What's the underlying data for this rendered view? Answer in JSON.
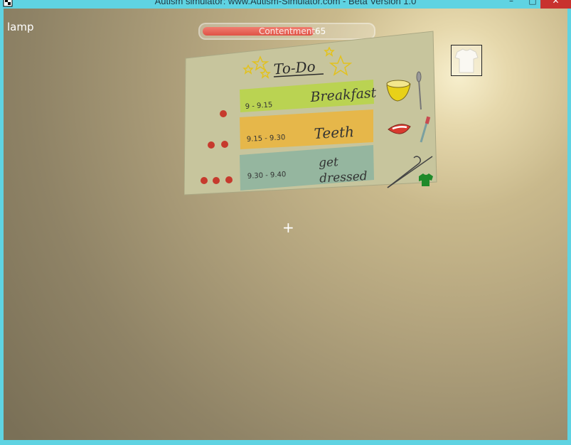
{
  "window": {
    "title": "Autism simulator: www.Autism-Simulator.com - Beta Version 1.0",
    "minimize_glyph": "–",
    "maximize_glyph": "□",
    "close_glyph": "✕"
  },
  "hud": {
    "hover_label": "lamp",
    "meter_label": "Contentment",
    "meter_value": "65",
    "meter_fraction": 0.65,
    "crosshair": "+",
    "held_item_icon": "tshirt-icon"
  },
  "todo": {
    "title": "To-Do",
    "tasks": [
      {
        "time": "9 - 9.15",
        "label": "Breakfast",
        "dots": 1,
        "color": "#b8d44a",
        "icon": "bowl-spoon-icon"
      },
      {
        "time": "9.15 - 9.30",
        "label": "Teeth",
        "dots": 2,
        "color": "#e9b541",
        "icon": "mouth-toothbrush-icon"
      },
      {
        "time": "9.30 - 9.40",
        "label": "get dressed",
        "dots": 3,
        "color": "#8fb4a0",
        "icon": "hanger-shirt-icon"
      }
    ]
  },
  "colors": {
    "window_chrome": "#5fd3e2",
    "close_button": "#c8322e",
    "meter_fill": "#df5246",
    "dot": "#c63a2d"
  }
}
